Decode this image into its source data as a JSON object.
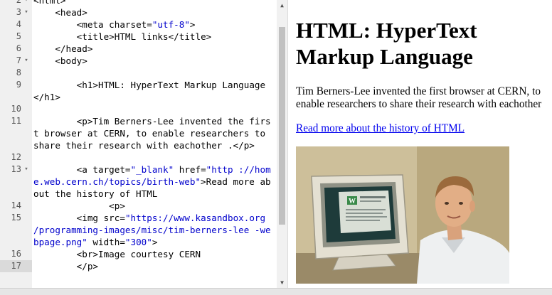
{
  "editor": {
    "lines": [
      {
        "num": "2",
        "fold": true,
        "html": "<span class='tag'>&lt;html&gt;</span>"
      },
      {
        "num": "3",
        "fold": true,
        "html": "<span class='indent'>    </span><span class='tag'>&lt;head&gt;</span>"
      },
      {
        "num": "4",
        "fold": false,
        "html": "<span class='indent'>        </span><span class='tag'>&lt;meta </span><span class='attr'>charset=</span><span class='str'>\"utf-8\"</span><span class='tag'>&gt;</span>"
      },
      {
        "num": "5",
        "fold": false,
        "html": "<span class='indent'>        </span><span class='tag'>&lt;title&gt;</span>HTML links<span class='tag'>&lt;/title&gt;</span>"
      },
      {
        "num": "6",
        "fold": false,
        "html": "<span class='indent'>    </span><span class='tag'>&lt;/head&gt;</span>"
      },
      {
        "num": "7",
        "fold": true,
        "html": "<span class='indent'>    </span><span class='tag'>&lt;body&gt;</span>"
      },
      {
        "num": "8",
        "fold": false,
        "html": " "
      },
      {
        "num": "9",
        "fold": false,
        "html": "<span class='indent'>        </span><span class='tag'>&lt;h1&gt;</span>HTML: HyperText Markup Language <span class='tag'>&lt;/h1&gt;</span>"
      },
      {
        "num": "10",
        "fold": false,
        "html": " "
      },
      {
        "num": "11",
        "fold": false,
        "html": "<span class='indent'>        </span><span class='tag'>&lt;p&gt;</span>Tim Berners-Lee invented the first browser at CERN, to enable researchers to share their research with eachother .<span class='tag'>&lt;/p&gt;</span>"
      },
      {
        "num": "12",
        "fold": false,
        "html": " "
      },
      {
        "num": "13",
        "fold": true,
        "html": "<span class='indent'>        </span><span class='tag'>&lt;a </span><span class='attr'>target=</span><span class='str'>\"_blank\"</span><span class='attr'> href=</span><span class='str'>\"http ://home.web.cern.ch/topics/birth-web\"</span><span class='tag'>&gt;</span>Read more about the history of HTML"
      },
      {
        "num": "14",
        "fold": false,
        "html": "<span class='indent'>              </span><span class='tag'>&lt;p&gt;</span>"
      },
      {
        "num": "15",
        "fold": false,
        "html": "<span class='indent'>        </span><span class='tag'>&lt;img </span><span class='attr'>src=</span><span class='str'>\"https://www.kasandbox.org /programming-images/misc/tim-berners-lee -webpage.png\"</span><span class='attr'> width=</span><span class='str'>\"300\"</span><span class='tag'>&gt;</span>"
      },
      {
        "num": "16",
        "fold": false,
        "html": "<span class='indent'>        </span><span class='tag'>&lt;br&gt;</span>Image courtesy CERN"
      },
      {
        "num": "17",
        "fold": false,
        "active": true,
        "html": "<span class='indent'>        </span><span class='tag'>&lt;/p&gt;</span>"
      }
    ]
  },
  "preview": {
    "heading_line1": "HTML: HyperText",
    "heading_line2": "Markup Language",
    "paragraph_line1": "Tim Berners-Lee invented the first browser at CERN, to",
    "paragraph_line2": "enable researchers to share their research with eachother",
    "link_text": "Read more about the history of HTML"
  },
  "colors": {
    "link": "#0000ee",
    "string": "#0000cc",
    "gutter_bg": "#f0f0f0",
    "active_line_gutter": "#dadada"
  }
}
